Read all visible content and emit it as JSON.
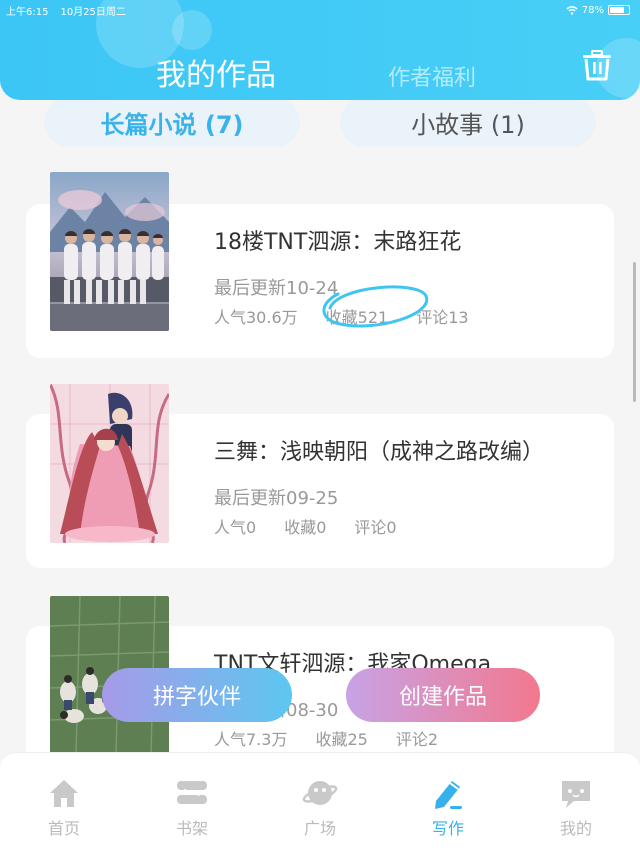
{
  "status_bar": {
    "time": "上午6:15",
    "date": "10月25日周二",
    "battery": "78%",
    "battery_level": 0.78
  },
  "header": {
    "title": "我的作品",
    "welfare_tab": "作者福利"
  },
  "segments": {
    "long_novel": "长篇小说 (7)",
    "short_story": "小故事 (1)"
  },
  "works": [
    {
      "title": "18楼TNT泗源：末路狂花",
      "updated": "最后更新10-24",
      "popularity": "人气30.6万",
      "favorites": "收藏521",
      "comments": "评论13"
    },
    {
      "title": "三舞：浅映朝阳（成神之路改编）",
      "updated": "最后更新09-25",
      "popularity": "人气0",
      "favorites": "收藏0",
      "comments": "评论0"
    },
    {
      "title": "TNT文轩泗源：我家Omega",
      "updated": "最后更新08-30",
      "popularity": "人气7.3万",
      "favorites": "收藏25",
      "comments": "评论2"
    }
  ],
  "actions": {
    "partner": "拼字伙伴",
    "create": "创建作品"
  },
  "tabbar": [
    {
      "label": "首页",
      "icon": "home-icon"
    },
    {
      "label": "书架",
      "icon": "bookshelf-icon"
    },
    {
      "label": "广场",
      "icon": "plaza-icon"
    },
    {
      "label": "写作",
      "icon": "write-icon"
    },
    {
      "label": "我的",
      "icon": "profile-icon"
    }
  ],
  "colors": {
    "accent": "#35b2ec",
    "header": "#3cc6f5",
    "circle_annotation": "#3ec5f0"
  }
}
